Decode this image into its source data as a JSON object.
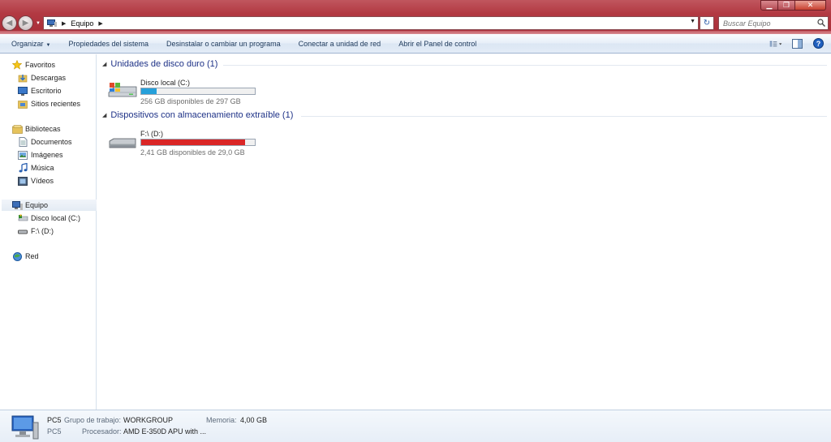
{
  "window": {
    "minimize_label": "▁",
    "maximize_label": "❐",
    "close_label": "✕"
  },
  "address": {
    "crumb": "Equipo"
  },
  "search": {
    "placeholder": "Buscar Equipo"
  },
  "toolbar": {
    "organize": "Organizar",
    "system_properties": "Propiedades del sistema",
    "uninstall": "Desinstalar o cambiar un programa",
    "map_drive": "Conectar a unidad de red",
    "control_panel": "Abrir el Panel de control"
  },
  "sidebar": {
    "favorites": "Favoritos",
    "downloads": "Descargas",
    "desktop": "Escritorio",
    "recent": "Sitios recientes",
    "libraries": "Bibliotecas",
    "documents": "Documentos",
    "images": "Imágenes",
    "music": "Música",
    "videos": "Vídeos",
    "computer": "Equipo",
    "local_disk": "Disco local (C:)",
    "removable": "F:\\ (D:)",
    "network": "Red"
  },
  "groups": {
    "hard_drives": "Unidades de disco duro (1)",
    "removable": "Dispositivos con almacenamiento extraíble (1)"
  },
  "drives": [
    {
      "name": "Disco local (C:)",
      "free_text": "256 GB disponibles de 297 GB",
      "used_fraction": 0.138,
      "bar_color": "#26a0da"
    },
    {
      "name": "F:\\ (D:)",
      "free_text": "2,41 GB disponibles de 29,0 GB",
      "used_fraction": 0.917,
      "bar_color": "#da2626"
    }
  ],
  "details": {
    "name": "PC5",
    "name2": "PC5",
    "workgroup_label": "Grupo de trabajo:",
    "workgroup_value": "WORKGROUP",
    "memory_label": "Memoria:",
    "memory_value": "4,00 GB",
    "processor_label": "Procesador:",
    "processor_value": "AMD E-350D APU with ..."
  }
}
